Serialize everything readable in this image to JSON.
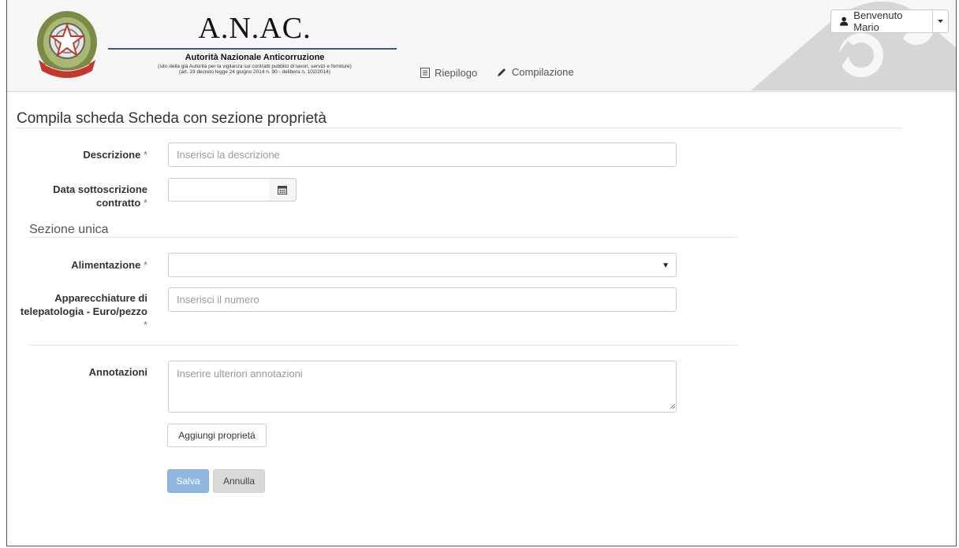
{
  "header": {
    "brand": {
      "title": "A.N.AC.",
      "subtitle": "Autorità Nazionale Anticorruzione",
      "note_line1": "(sito della già Autorità per la vigilanza sui contratti pubblici di lavori, servizi e forniture)",
      "note_line2": "(art. 19 decreto legge 24 giugno 2014 n. 90 - delibera n. 102/2014)"
    },
    "nav": [
      {
        "label": "Riepilogo",
        "icon": "list-icon"
      },
      {
        "label": "Compilazione",
        "icon": "pencil-icon"
      }
    ],
    "user": {
      "label": "Benvenuto Mario",
      "icon": "user-icon"
    }
  },
  "form": {
    "title": "Compila scheda Scheda con sezione proprietà",
    "descrizione": {
      "label": "Descrizione",
      "required_mark": " *",
      "placeholder": "Inserisci la descrizione",
      "value": ""
    },
    "data": {
      "label_line1": "Data sottoscrizione",
      "label_line2": "contratto",
      "required_mark": " *",
      "value": "",
      "icon": "calendar-icon"
    },
    "section_title": "Sezione unica",
    "alimentazione": {
      "label": "Alimentazione",
      "required_mark": " *",
      "selected": ""
    },
    "apparecchiature": {
      "label_line1": "Apparecchiature di",
      "label_line2": "telepatologia - Euro/pezzo",
      "required_mark": "*",
      "placeholder": "Inserisci il numero",
      "value": ""
    },
    "annotazioni": {
      "label": "Annotazioni",
      "placeholder": "Inserire ulteriori annotazioni",
      "value": ""
    },
    "add_property_label": "Aggiungi proprietá",
    "save_label": "Salva",
    "cancel_label": "Annulla"
  },
  "colors": {
    "primary": "#8fb7e0",
    "header_bg": "#f6f6f6",
    "brand_rule": "#3b5a8c"
  }
}
